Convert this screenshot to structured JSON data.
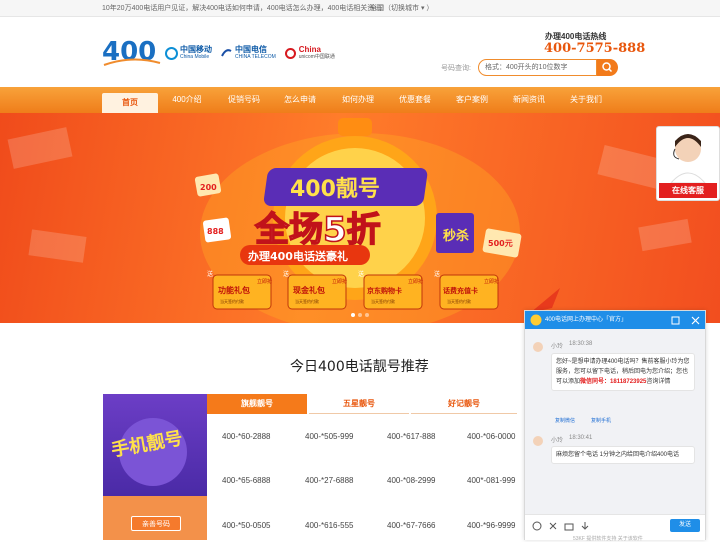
{
  "topbar": {
    "notice": "10年20万400电话用户见证，解决400电话如何申请，400电话怎么办理，400电话相关资讯！",
    "city": "全国（切换城市 ▾ ）"
  },
  "header": {
    "logo": "400",
    "carriers": [
      {
        "cn": "中国移动",
        "en": "China Mobile"
      },
      {
        "cn": "中国电信",
        "en": "CHINA TELECOM"
      },
      {
        "cn": "China",
        "en": "unicom中国联通"
      }
    ],
    "hotline_label": "办理400电话热线",
    "hotline_number": "400-7575-888",
    "search_label": "号码查询:",
    "search_placeholder": "格式：400开头的10位数字"
  },
  "nav": [
    "首页",
    "400介绍",
    "促销号码",
    "怎么申请",
    "如何办理",
    "优惠套餐",
    "客户案例",
    "新闻资讯",
    "关于我们"
  ],
  "nav_active": 0,
  "banner": {
    "title": "400靓号",
    "big": "全场5折",
    "seckill": "秒杀",
    "sub": "办理400电话送豪礼",
    "badge200": "200",
    "badge888": "888",
    "badge500": "500元",
    "gifts": [
      {
        "top": "送",
        "name": "功能礼包",
        "sub": "当天签约付款"
      },
      {
        "top": "送",
        "name": "现金礼包",
        "sub": "当天签约付款"
      },
      {
        "top": "送",
        "name": "京东购物卡",
        "sub": "当天签约付款"
      },
      {
        "top": "送",
        "name": "话费充值卡",
        "sub": "当天签约付款"
      }
    ],
    "slot": "立即抢"
  },
  "service": {
    "label": "在线客服"
  },
  "section_title": "今日400电话靓号推荐",
  "promo": {
    "text": "手机靓号",
    "tag": "亲善号码"
  },
  "tabs": [
    "旗舰靓号",
    "五星靓号",
    "好记靓号"
  ],
  "numbers": [
    [
      "400-*60-2888",
      "400-*505-999",
      "400-*617-888",
      "400-*06-0000"
    ],
    [
      "400-*65-6888",
      "400-*27-6888",
      "400-*08-2999",
      "400*-081-999"
    ],
    [
      "400-*50-0505",
      "400-*616-555",
      "400-*67-7666",
      "400-*96-9999"
    ]
  ],
  "chat": {
    "title": "400电话网上办理中心「官方」",
    "m1_name": "小玲",
    "m1_time": "18:30:38",
    "m1_a": "您好~是想申请办理400电话吗？售前客服小玲为您服务，您可以留下电话，稍后回电为您介绍；您也可以添加",
    "m1_wx": "微信同号：18118723925",
    "m1_b": "咨询详情",
    "link1": "复制微信",
    "link2": "复制手机",
    "m2_name": "小玲",
    "m2_time": "18:30:41",
    "m2_text": "麻烦您留个电话 1分钟之内给回电介绍400电话",
    "send": "发送",
    "powered": "53KF 提供软件支持  关于该软件"
  }
}
